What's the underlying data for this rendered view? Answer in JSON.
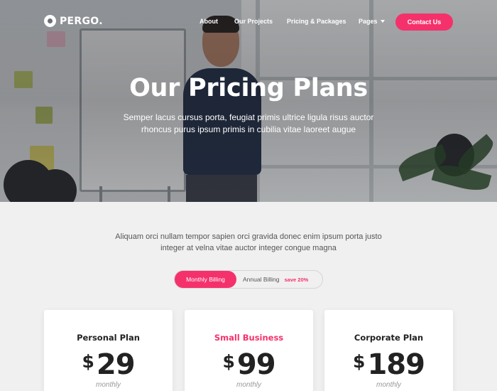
{
  "brand": {
    "logo_text": "PERGO."
  },
  "nav": {
    "items": [
      {
        "label": "About"
      },
      {
        "label": "Our Projects"
      },
      {
        "label": "Pricing & Packages"
      },
      {
        "label": "Pages"
      }
    ],
    "contact_label": "Contact Us"
  },
  "hero": {
    "title": "Our Pricing Plans",
    "subtitle": "Semper lacus cursus porta, feugiat primis ultrice ligula risus auctor rhoncus purus ipsum primis in cubilia vitae laoreet augue"
  },
  "intro": "Aliquam orci nullam tempor sapien orci gravida donec enim ipsum porta justo integer at velna vitae auctor integer congue magna",
  "billing": {
    "monthly_label": "Monthly Billing",
    "annual_label": "Annual Billing",
    "save_label": "save 20%",
    "selected": "Monthly Billing"
  },
  "plans": [
    {
      "name": "Personal Plan",
      "currency": "$",
      "price": "29",
      "period": "monthly",
      "highlight": false
    },
    {
      "name": "Small Business",
      "currency": "$",
      "price": "99",
      "period": "monthly",
      "highlight": true
    },
    {
      "name": "Corporate Plan",
      "currency": "$",
      "price": "189",
      "period": "monthly",
      "highlight": false
    }
  ],
  "colors": {
    "accent": "#f5316b",
    "page_bg": "#f0f0f0",
    "card_bg": "#ffffff"
  },
  "icons": {
    "logo": "pergo-logo-icon",
    "dropdown": "chevron-down-icon"
  }
}
